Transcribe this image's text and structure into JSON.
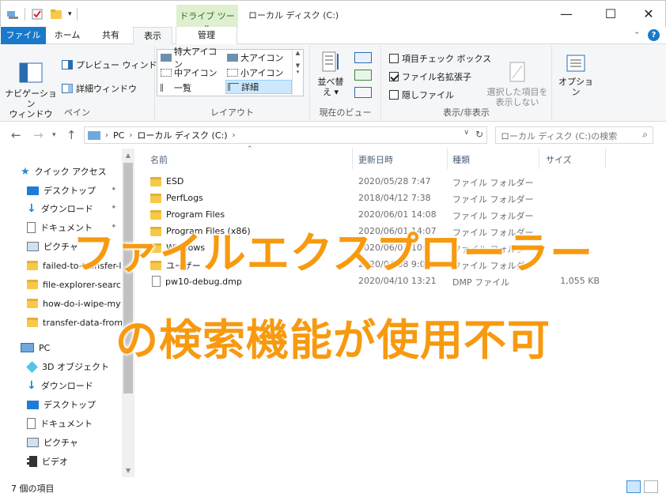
{
  "window": {
    "title": "ローカル ディスク (C:)",
    "contextual_tab_header": "ドライブ ツール",
    "minimize": "—",
    "maximize": "☐",
    "close": "✕"
  },
  "tabs": [
    {
      "label": "ファイル"
    },
    {
      "label": "ホーム"
    },
    {
      "label": "共有"
    },
    {
      "label": "表示"
    },
    {
      "label": "管理"
    }
  ],
  "ribbon": {
    "pane_group": {
      "label": "ペイン",
      "nav_pane": "ナビゲーション\nウィンドウ",
      "preview": "プレビュー ウィンドウ",
      "details": "詳細ウィンドウ"
    },
    "layout_group": {
      "label": "レイアウト",
      "items": [
        "特大アイコン",
        "大アイコン",
        "中アイコン",
        "小アイコン",
        "一覧",
        "詳細"
      ],
      "selected": "詳細"
    },
    "current_view_group": {
      "label": "現在のビュー",
      "sort_by": "並べ替え"
    },
    "show_hide_group": {
      "label": "表示/非表示",
      "checkboxes": [
        {
          "label": "項目チェック ボックス",
          "checked": false
        },
        {
          "label": "ファイル名拡張子",
          "checked": true
        },
        {
          "label": "隠しファイル",
          "checked": false
        }
      ],
      "hide_selected": "選択した項目を\n表示しない"
    },
    "options": "オプション"
  },
  "address": {
    "crumbs": [
      "PC",
      "ローカル ディスク (C:)"
    ],
    "search_placeholder": "ローカル ディスク (C:)の検索"
  },
  "sidebar": {
    "items": [
      {
        "label": "クイック アクセス",
        "icon": "star-icon"
      },
      {
        "label": "デスクトップ",
        "icon": "desktop-icon",
        "pinned": true
      },
      {
        "label": "ダウンロード",
        "icon": "download-icon",
        "pinned": true
      },
      {
        "label": "ドキュメント",
        "icon": "document-icon",
        "pinned": true
      },
      {
        "label": "ピクチャ",
        "icon": "pictures-icon"
      },
      {
        "label": "failed-to-transfer-l",
        "icon": "folder-icon"
      },
      {
        "label": "file-explorer-searcl",
        "icon": "folder-icon"
      },
      {
        "label": "how-do-i-wipe-my",
        "icon": "folder-icon"
      },
      {
        "label": "transfer-data-from",
        "icon": "folder-icon"
      },
      {
        "label": "PC",
        "icon": "pc-icon"
      },
      {
        "label": "3D オブジェクト",
        "icon": "cube-icon"
      },
      {
        "label": "ダウンロード",
        "icon": "download-icon"
      },
      {
        "label": "デスクトップ",
        "icon": "desktop-icon"
      },
      {
        "label": "ドキュメント",
        "icon": "document-icon"
      },
      {
        "label": "ピクチャ",
        "icon": "pictures-icon"
      },
      {
        "label": "ビデオ",
        "icon": "video-icon"
      }
    ]
  },
  "file_list": {
    "columns": [
      "名前",
      "更新日時",
      "種類",
      "サイズ"
    ],
    "rows": [
      {
        "name": "ESD",
        "date": "2020/05/28 7:47",
        "type": "ファイル フォルダー",
        "size": "",
        "icon": "folder-icon"
      },
      {
        "name": "PerfLogs",
        "date": "2018/04/12 7:38",
        "type": "ファイル フォルダー",
        "size": "",
        "icon": "folder-icon"
      },
      {
        "name": "Program Files",
        "date": "2020/06/01 14:08",
        "type": "ファイル フォルダー",
        "size": "",
        "icon": "folder-icon"
      },
      {
        "name": "Program Files (x86)",
        "date": "2020/06/01 14:07",
        "type": "ファイル フォルダー",
        "size": "",
        "icon": "folder-icon"
      },
      {
        "name": "Windows",
        "date": "2020/06/01 10:4",
        "type": "ファイル フォルダー",
        "size": "",
        "icon": "folder-icon"
      },
      {
        "name": "ユーザー",
        "date": "2020/04/08 9:07",
        "type": "ファイル フォルダー",
        "size": "",
        "icon": "folder-icon"
      },
      {
        "name": "pw10-debug.dmp",
        "date": "2020/04/10 13:21",
        "type": "DMP ファイル",
        "size": "1,055 KB",
        "icon": "file-icon"
      }
    ]
  },
  "status": {
    "item_count": "7 個の項目"
  },
  "overlay": {
    "line1": "ファイルエクスプローラー",
    "line2": "の検索機能が使用不可"
  },
  "colors": {
    "accent": "#1979ca",
    "overlay_text": "#f79a10",
    "contextual_tab": "#dff0d1",
    "folder": "#f7c948"
  }
}
